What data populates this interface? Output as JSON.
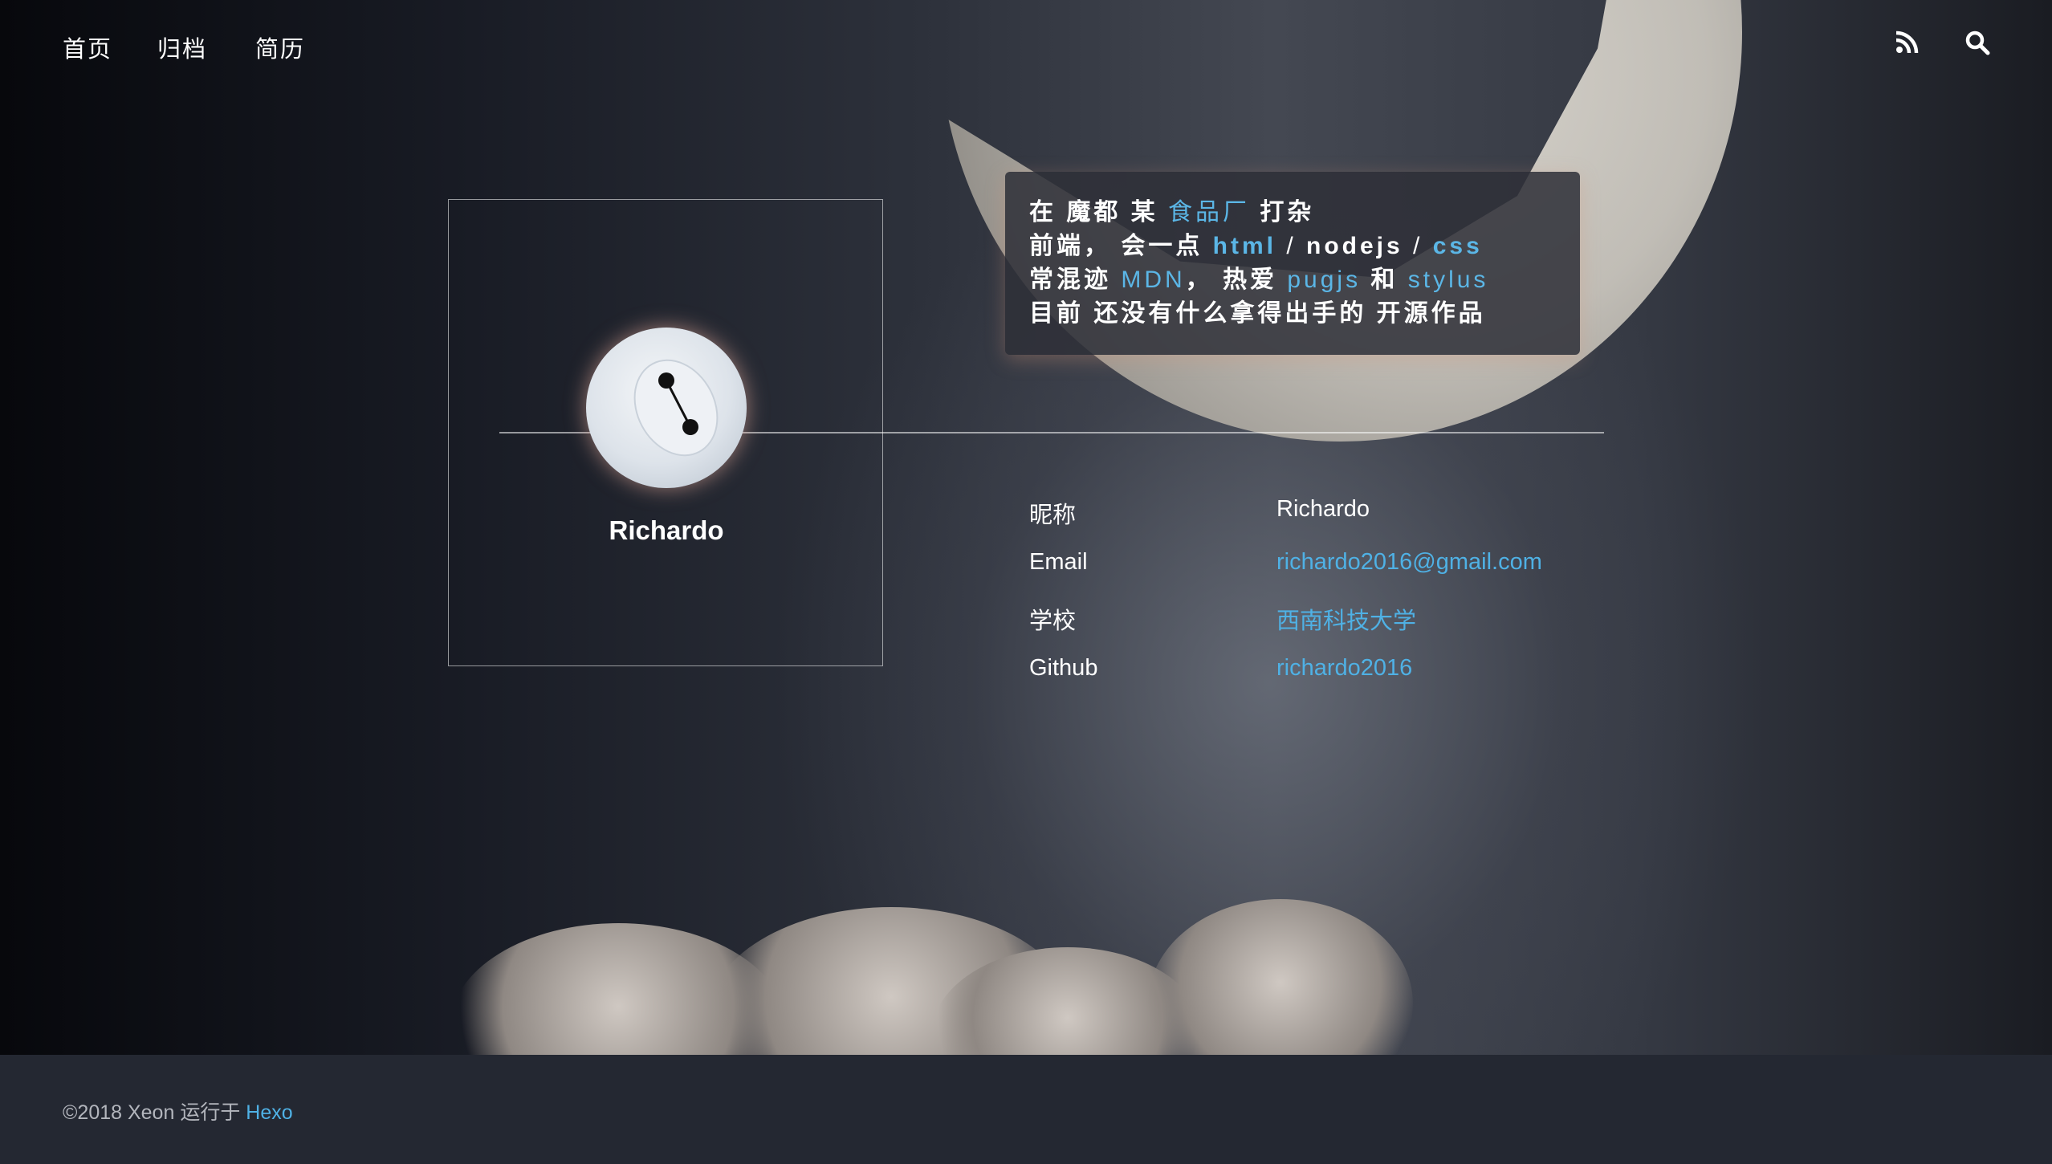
{
  "nav": {
    "items": [
      {
        "label": "首页"
      },
      {
        "label": "归档"
      },
      {
        "label": "简历"
      }
    ],
    "icons": [
      "rss-icon",
      "search-icon"
    ]
  },
  "profile": {
    "name": "Richardo"
  },
  "bio": {
    "line1": {
      "a": "在 魔都 某 ",
      "link": "食品厂",
      "b": " 打杂"
    },
    "line2": {
      "a": "前端， 会一点 ",
      "html": "html",
      "sep1": " / ",
      "nodejs": "nodejs",
      "sep2": " / ",
      "css": "css"
    },
    "line3": {
      "a": "常混迹 ",
      "mdn": "MDN",
      "b": "， 热爱 ",
      "pugjs": "pugjs",
      "c": " 和 ",
      "stylus": "stylus"
    },
    "line4": "目前 还没有什么拿得出手的 开源作品"
  },
  "info": [
    {
      "label": "昵称",
      "value": "Richardo"
    },
    {
      "label": "Email",
      "value": "richardo2016@gmail.com"
    },
    {
      "label": "学校",
      "value": "西南科技大学"
    },
    {
      "label": "Github",
      "value": "richardo2016"
    }
  ],
  "footer": {
    "text": "©2018 Xeon 运行于 ",
    "link": "Hexo"
  },
  "colors": {
    "accent": "#4fb1e5",
    "footer_bg": "#242832"
  }
}
